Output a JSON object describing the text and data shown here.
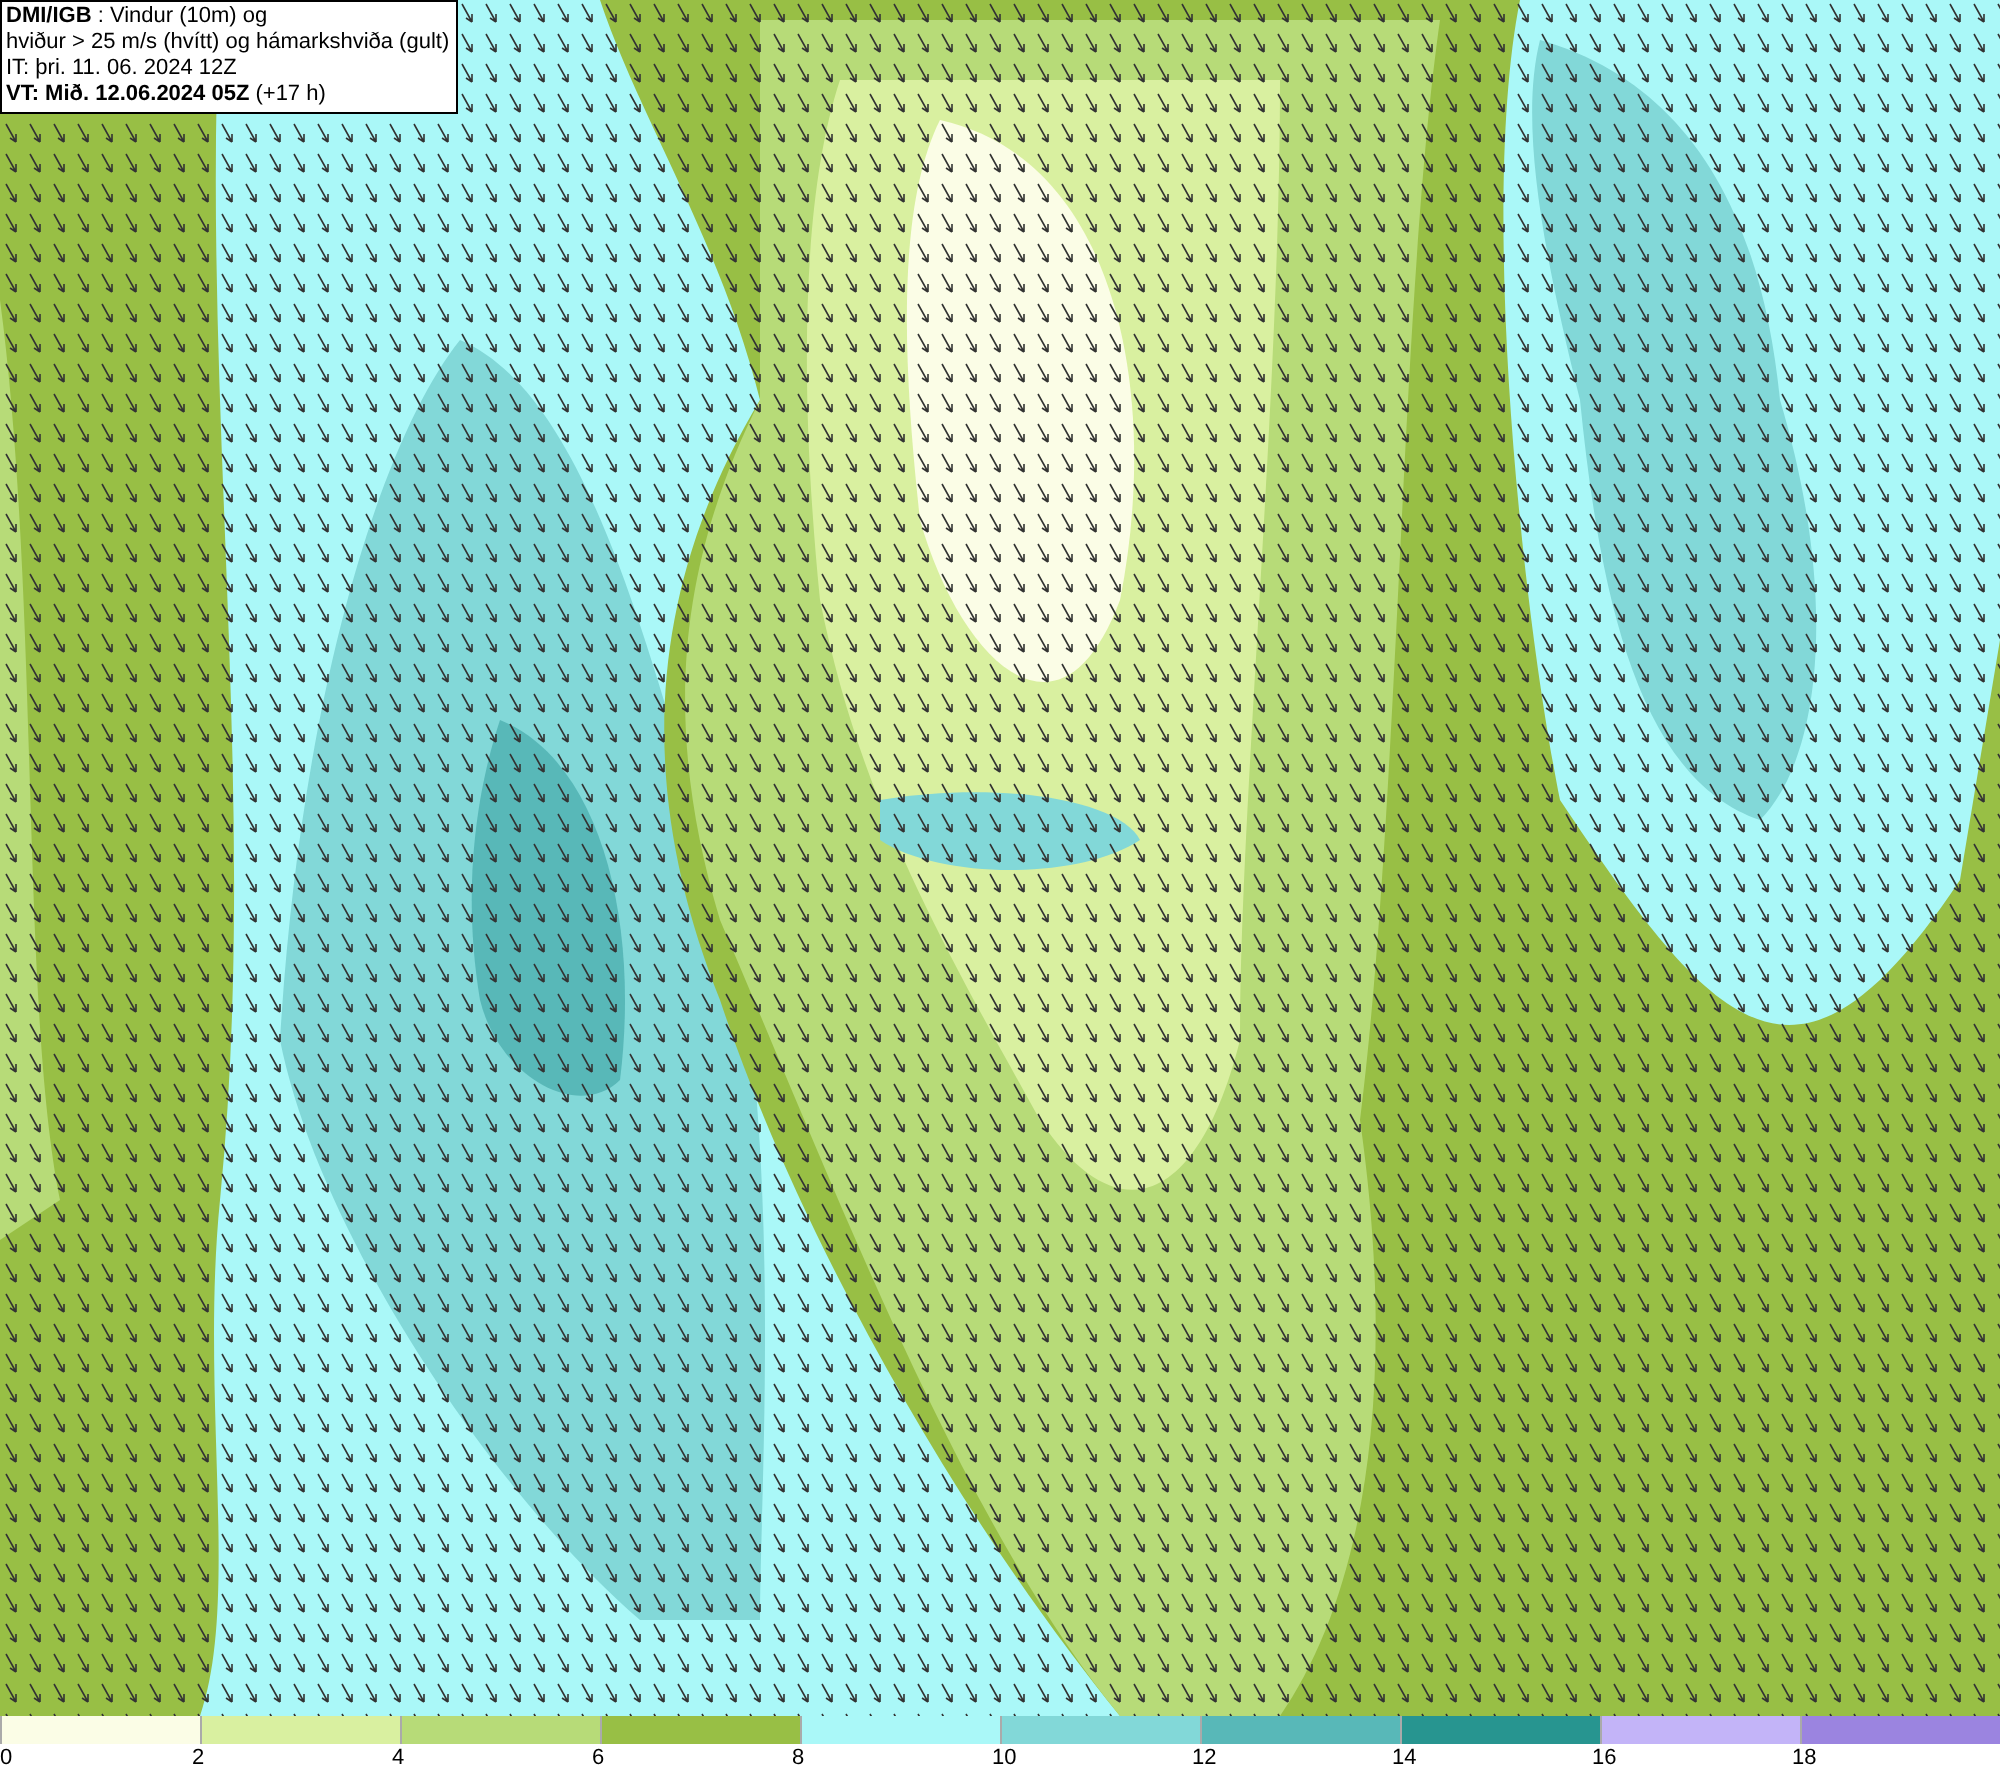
{
  "title_box": {
    "lines": [
      "**DMI/IGB** : Vindur (10m) og",
      "hviður > 25 m/s (hvítt) og hámarkshviða (gult)",
      "IT: þri. 11. 06. 2024 12Z",
      "**VT: Mið. 12.06.2024 05Z** (+17 h)"
    ]
  },
  "legend": {
    "bins": [
      {
        "label": "0",
        "color": "#fbfde6"
      },
      {
        "label": "2",
        "color": "#d9f0a0"
      },
      {
        "label": "4",
        "color": "#b7db78"
      },
      {
        "label": "6",
        "color": "#98bf45"
      },
      {
        "label": "8",
        "color": "#aaf8f8"
      },
      {
        "label": "10",
        "color": "#82d8d8"
      },
      {
        "label": "12",
        "color": "#58b8b8"
      },
      {
        "label": "14",
        "color": "#279590"
      },
      {
        "label": "16",
        "color": "#c3b4f8"
      },
      {
        "label": "18",
        "color": "#9b84e0"
      }
    ]
  }
}
